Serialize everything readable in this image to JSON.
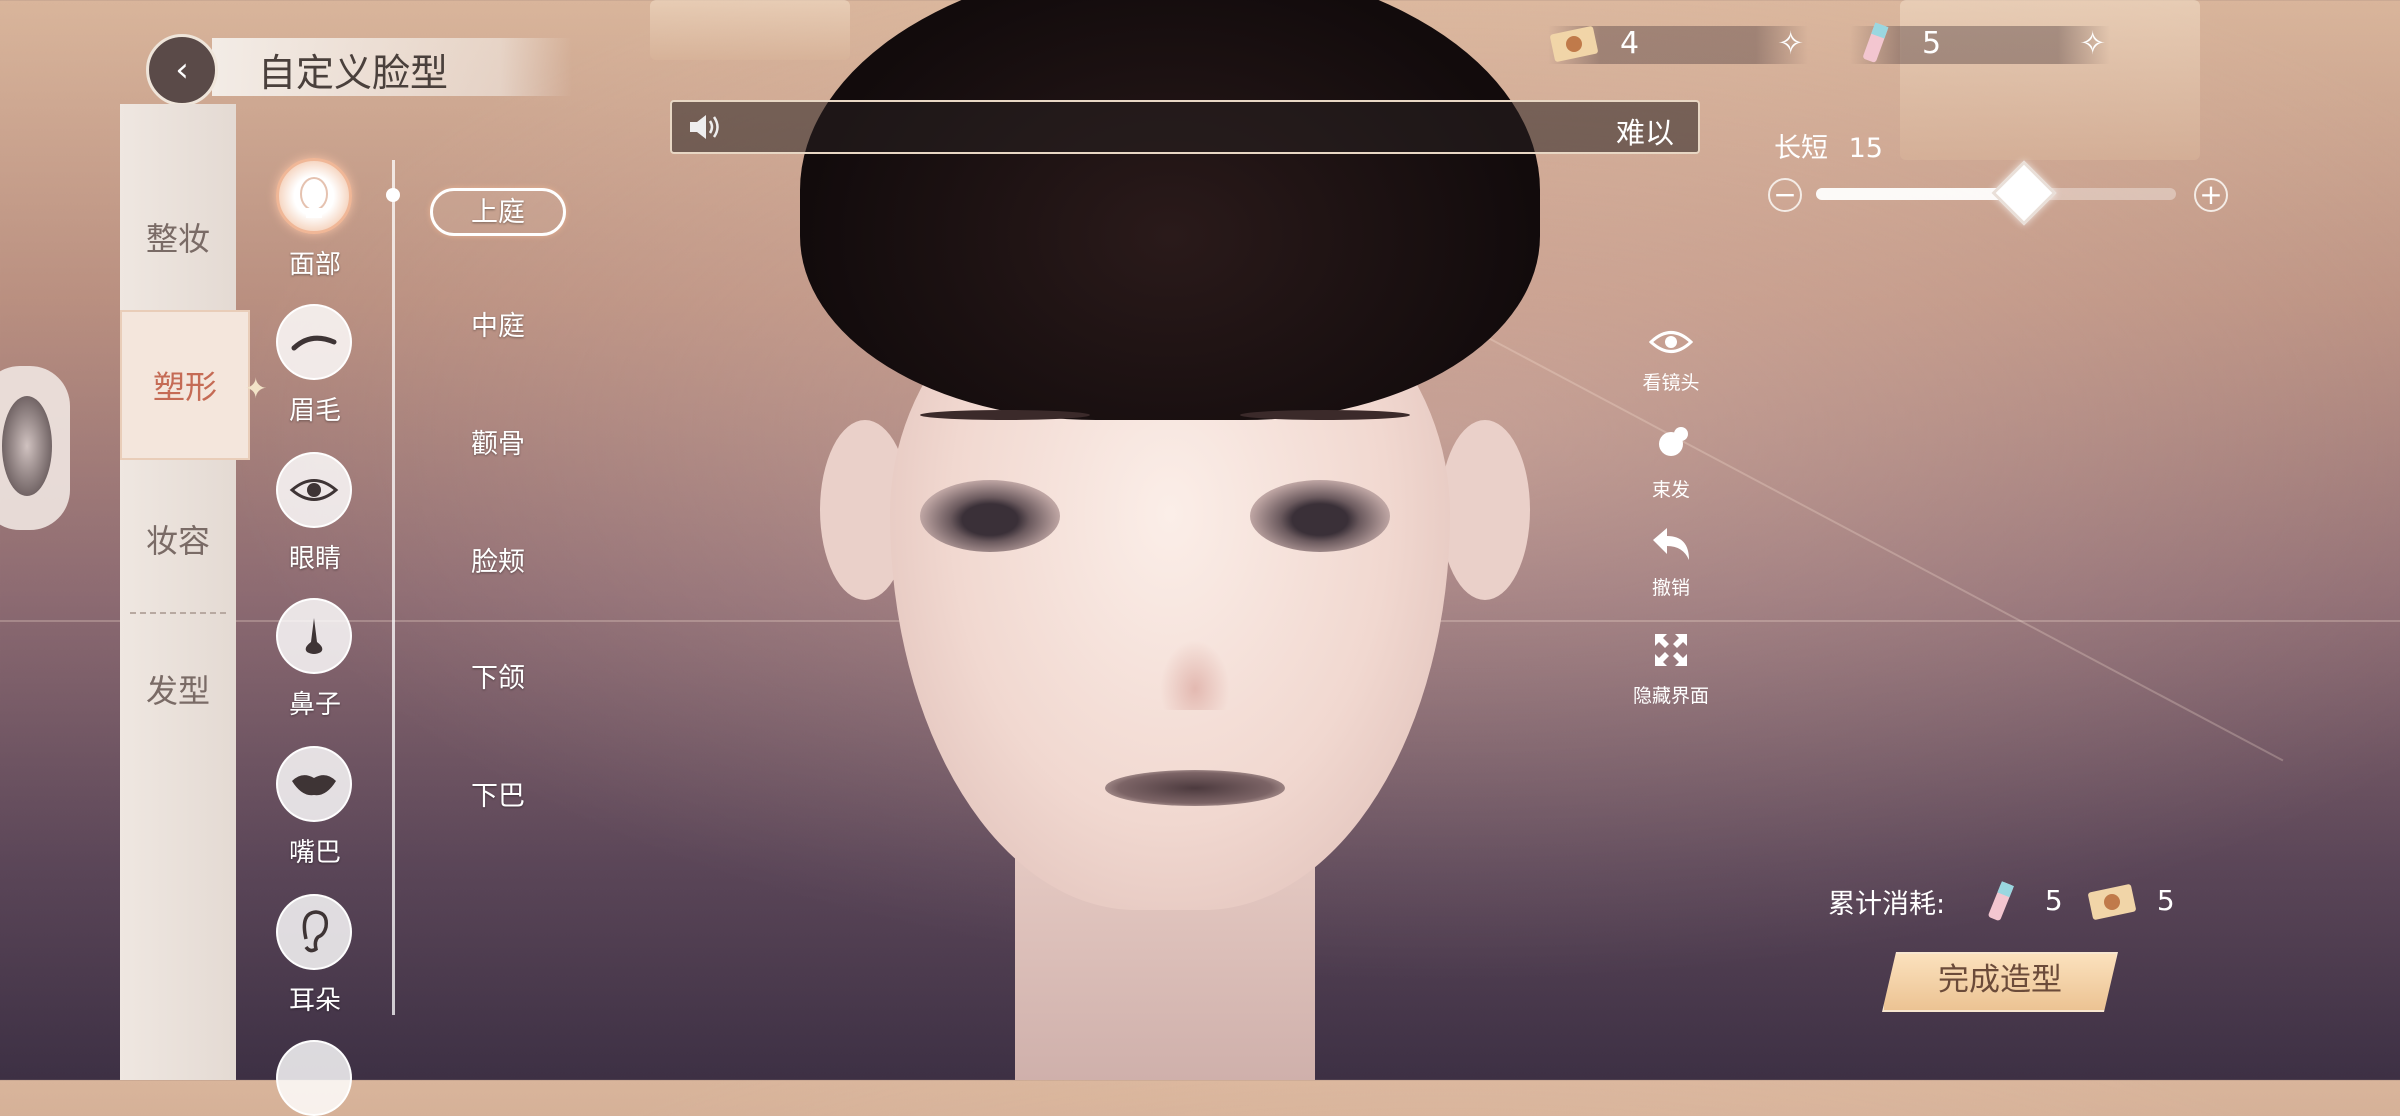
{
  "header": {
    "title": "自定义脸型",
    "back_icon": "back-icon"
  },
  "voice_banner": {
    "icon": "speaker-icon",
    "text": "难以"
  },
  "currencies": [
    {
      "icon": "ticket-icon",
      "value": "4",
      "add_icon": "add-sparkle-icon"
    },
    {
      "icon": "tube-icon",
      "value": "5",
      "add_icon": "add-sparkle-icon"
    }
  ],
  "slider": {
    "label": "长短",
    "value": "15",
    "fraction": 0.57,
    "minus": "−",
    "plus": "+"
  },
  "categories": [
    {
      "label": "整妆"
    },
    {
      "label": "塑形",
      "active": true
    },
    {
      "label": "妆容"
    },
    {
      "label": "发型"
    }
  ],
  "parts": [
    {
      "label": "面部",
      "icon": "face-icon",
      "active": true
    },
    {
      "label": "眉毛",
      "icon": "eyebrow-icon"
    },
    {
      "label": "眼睛",
      "icon": "eye-icon"
    },
    {
      "label": "鼻子",
      "icon": "nose-icon"
    },
    {
      "label": "嘴巴",
      "icon": "lips-icon"
    },
    {
      "label": "耳朵",
      "icon": "ear-icon"
    }
  ],
  "subcategories": [
    {
      "label": "上庭",
      "active": true
    },
    {
      "label": "中庭"
    },
    {
      "label": "颧骨"
    },
    {
      "label": "脸颊"
    },
    {
      "label": "下颌"
    },
    {
      "label": "下巴"
    }
  ],
  "tools": [
    {
      "label": "看镜头",
      "icon": "eye-look-icon"
    },
    {
      "label": "束发",
      "icon": "hair-tie-icon"
    },
    {
      "label": "撤销",
      "icon": "undo-icon"
    },
    {
      "label": "隐藏界面",
      "icon": "hide-ui-icon"
    }
  ],
  "cost": {
    "label": "累计消耗:",
    "items": [
      {
        "icon": "tube-icon",
        "value": "5"
      },
      {
        "icon": "ticket-icon",
        "value": "5"
      }
    ]
  },
  "done_button": {
    "label": "完成造型"
  }
}
